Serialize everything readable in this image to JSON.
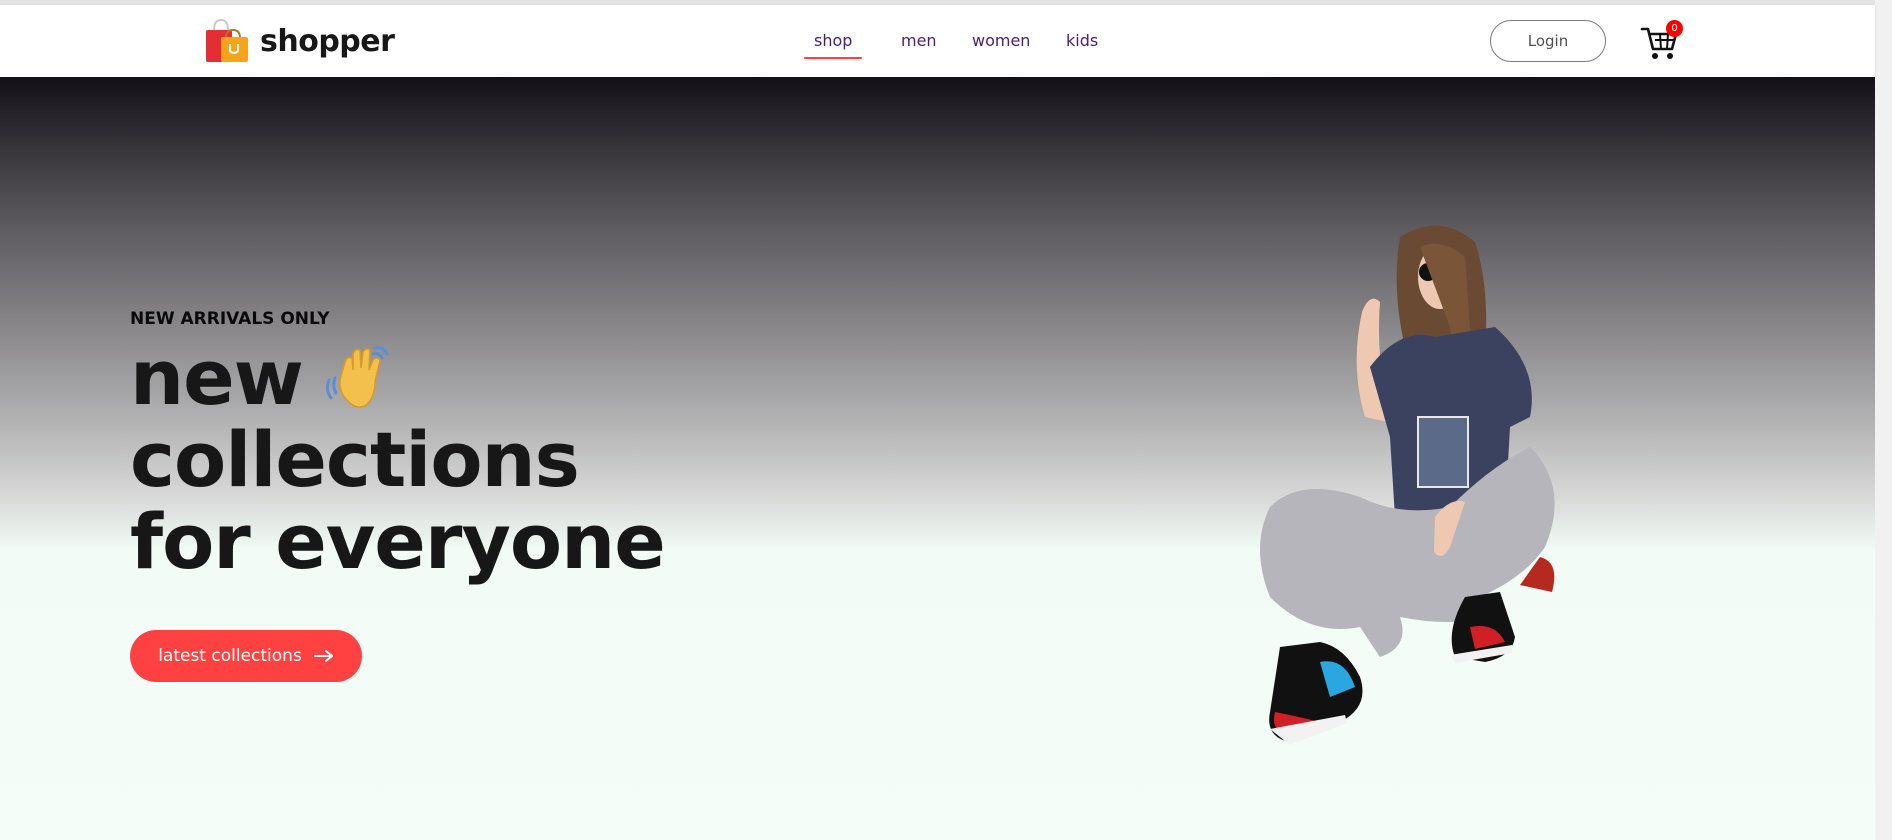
{
  "brand": {
    "name": "shopper",
    "logo_icon": "shopping-bag-icon"
  },
  "nav": {
    "items": [
      {
        "label": "shop",
        "active": true
      },
      {
        "label": "men",
        "active": false
      },
      {
        "label": "women",
        "active": false
      },
      {
        "label": "kids",
        "active": false
      }
    ],
    "login_label": "Login",
    "cart_icon": "cart-icon",
    "cart_count": "0"
  },
  "hero": {
    "tag": "NEW ARRIVALS ONLY",
    "title_lines": [
      "new",
      "collections",
      "for everyone"
    ],
    "wave_icon": "waving-hand-icon",
    "cta_label": "latest collections",
    "cta_icon": "arrow-right-icon",
    "image": "hero-model-image"
  },
  "colors": {
    "accent": "#ff4141",
    "nav_text": "#4a2175",
    "text_dark": "#171717",
    "hero_top": "#141017",
    "hero_bottom": "#f5fdf9"
  }
}
